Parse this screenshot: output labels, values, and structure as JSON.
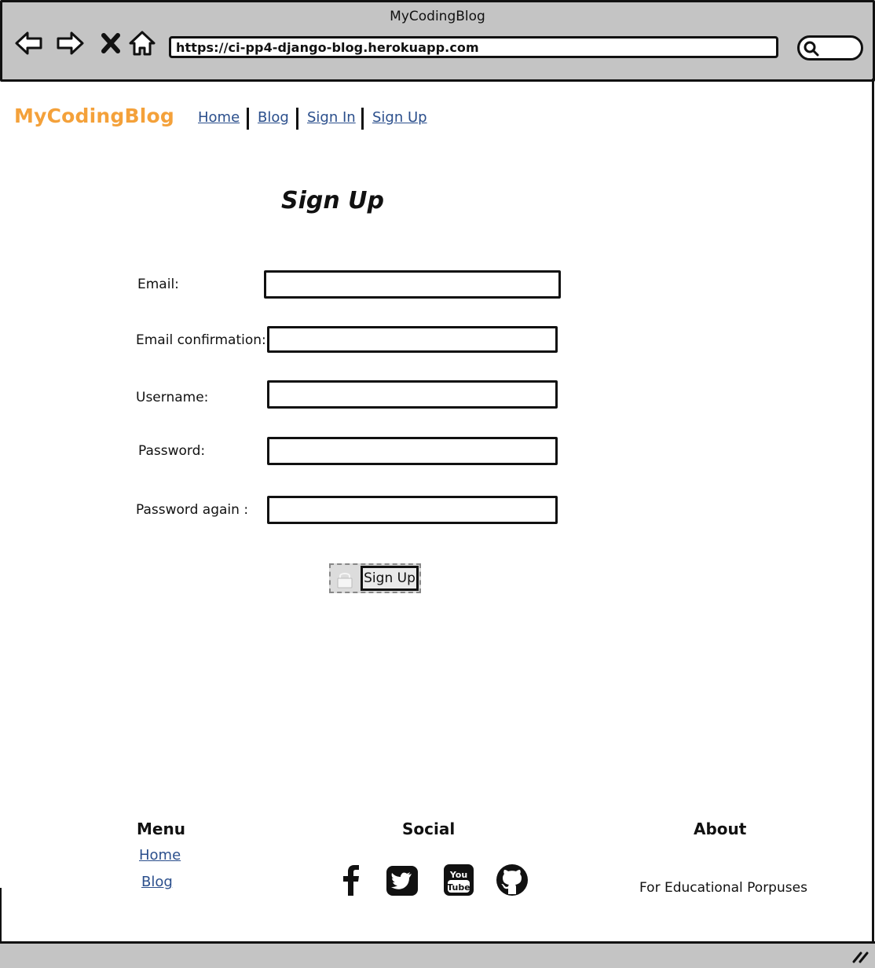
{
  "window": {
    "title": "MyCodingBlog",
    "url": "https://ci-pp4-django-blog.herokuapp.com"
  },
  "browser_icons": [
    "back-arrow-icon",
    "forward-arrow-icon",
    "stop-icon",
    "home-icon",
    "search-icon"
  ],
  "site": {
    "brand": "MyCodingBlog",
    "brand_color": "#f4a13a",
    "link_color": "#2b4f8c",
    "nav": [
      {
        "label": "Home"
      },
      {
        "label": "Blog"
      },
      {
        "label": "Sign In"
      },
      {
        "label": "Sign Up"
      }
    ]
  },
  "form": {
    "heading": "Sign Up",
    "fields": [
      {
        "label": "Email:",
        "value": ""
      },
      {
        "label": "Email confirmation:",
        "value": ""
      },
      {
        "label": "Username:",
        "value": ""
      },
      {
        "label": "Password:",
        "value": ""
      },
      {
        "label": "Password again :",
        "value": ""
      }
    ],
    "submit_label": "Sign Up"
  },
  "footer": {
    "menu": {
      "heading": "Menu",
      "links": [
        "Home",
        "Blog"
      ]
    },
    "social": {
      "heading": "Social",
      "icons": [
        "facebook-icon",
        "twitter-icon",
        "youtube-icon",
        "github-icon"
      ]
    },
    "about": {
      "heading": "About",
      "text": "For Educational Porpuses"
    }
  }
}
